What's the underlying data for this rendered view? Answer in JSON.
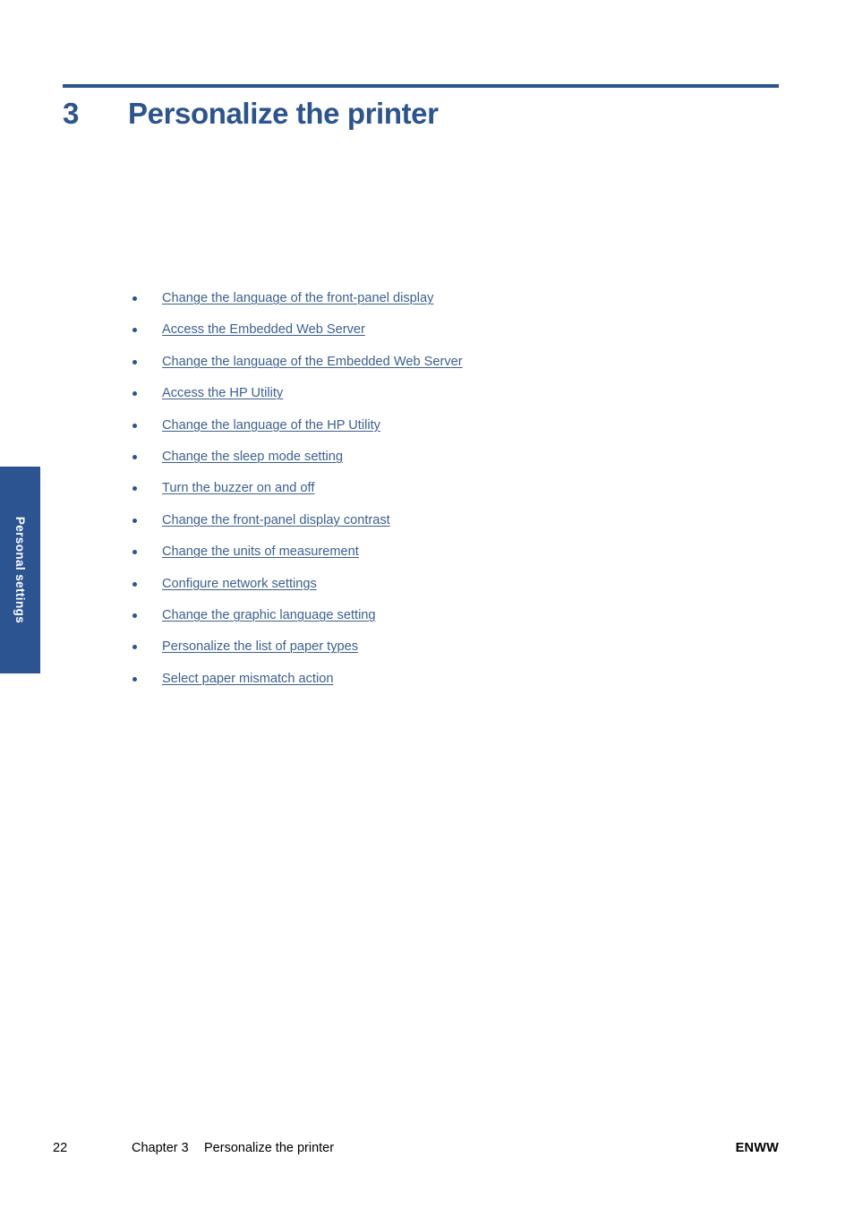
{
  "colors": {
    "accent_blue": "#2b5490",
    "link_blue": "#3c5f93",
    "tab_fill": "#2b5490",
    "tab_text": "#ffffff",
    "body_text": "#000000"
  },
  "heading": {
    "number": "3",
    "title": "Personalize the printer"
  },
  "side_tab": {
    "label": "Personal settings"
  },
  "links": [
    {
      "label": "Change the language of the front-panel display"
    },
    {
      "label": "Access the Embedded Web Server"
    },
    {
      "label": "Change the language of the Embedded Web Server"
    },
    {
      "label": "Access the HP Utility"
    },
    {
      "label": "Change the language of the HP Utility"
    },
    {
      "label": "Change the sleep mode setting"
    },
    {
      "label": "Turn the buzzer on and off"
    },
    {
      "label": "Change the front-panel display contrast"
    },
    {
      "label": "Change the units of measurement"
    },
    {
      "label": "Configure network settings"
    },
    {
      "label": "Change the graphic language setting"
    },
    {
      "label": "Personalize the list of paper types"
    },
    {
      "label": "Select paper mismatch action"
    }
  ],
  "footer": {
    "page_number": "22",
    "chapter": "Chapter 3",
    "chapter_title": "Personalize the printer",
    "locale": "ENWW"
  }
}
